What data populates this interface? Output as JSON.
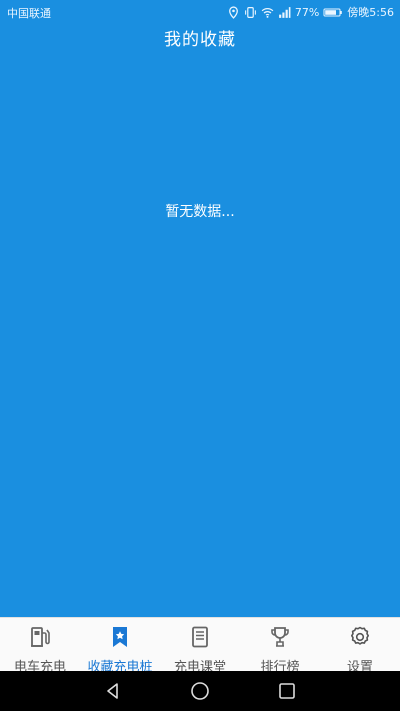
{
  "status_bar": {
    "carrier": "中国联通",
    "battery": "77%",
    "time": "傍晚5:56"
  },
  "header": {
    "title": "我的收藏"
  },
  "main": {
    "empty_message": "暂无数据..."
  },
  "tabs": [
    {
      "label": "电车充电",
      "icon": "gas-pump-icon",
      "active": false
    },
    {
      "label": "收藏充电桩",
      "icon": "bookmark-star-icon",
      "active": true
    },
    {
      "label": "充电课堂",
      "icon": "book-icon",
      "active": false
    },
    {
      "label": "排行榜",
      "icon": "trophy-icon",
      "active": false
    },
    {
      "label": "设置",
      "icon": "gear-icon",
      "active": false
    }
  ],
  "colors": {
    "primary": "#1a8fe0",
    "tab_active": "#1a78d4",
    "tab_inactive": "#555555",
    "tab_bg": "#fafafa"
  }
}
